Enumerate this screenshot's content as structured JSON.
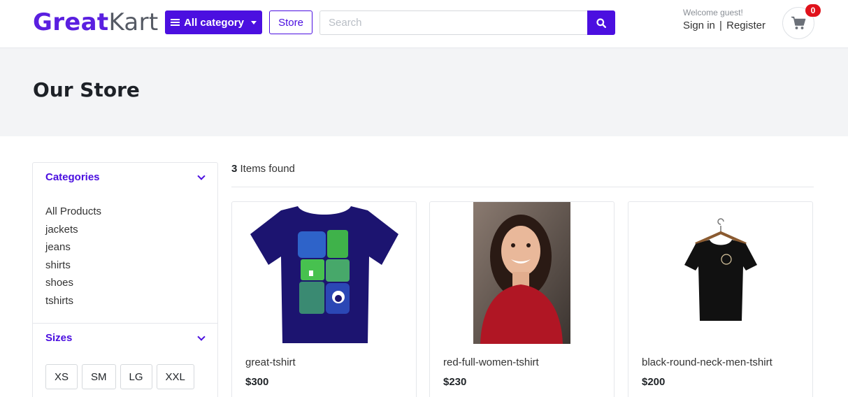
{
  "header": {
    "logo_part1": "Great",
    "logo_part2": "Kart",
    "category_button": "All category",
    "store_button": "Store",
    "search_placeholder": "Search",
    "welcome": "Welcome guest!",
    "sign_in": "Sign in",
    "separator": "|",
    "register": "Register",
    "cart_count": "0",
    "icons": {
      "menu": "menu-icon",
      "search": "search-icon",
      "cart": "cart-icon"
    }
  },
  "banner": {
    "title": "Our Store"
  },
  "sidebar": {
    "categories_title": "Categories",
    "categories": [
      "All Products",
      "jackets",
      "jeans",
      "shirts",
      "shoes",
      "tshirts"
    ],
    "sizes_title": "Sizes",
    "sizes": [
      "XS",
      "SM",
      "LG",
      "XXL"
    ]
  },
  "main": {
    "count": "3",
    "count_label": " Items found",
    "products": [
      {
        "name": "great-tshirt",
        "price": "$300"
      },
      {
        "name": "red-full-women-tshirt",
        "price": "$230"
      },
      {
        "name": "black-round-neck-men-tshirt",
        "price": "$200"
      }
    ]
  },
  "colors": {
    "brand": "#4b0fe0",
    "badge": "#e0121b",
    "banner_bg": "#f3f4f6"
  }
}
